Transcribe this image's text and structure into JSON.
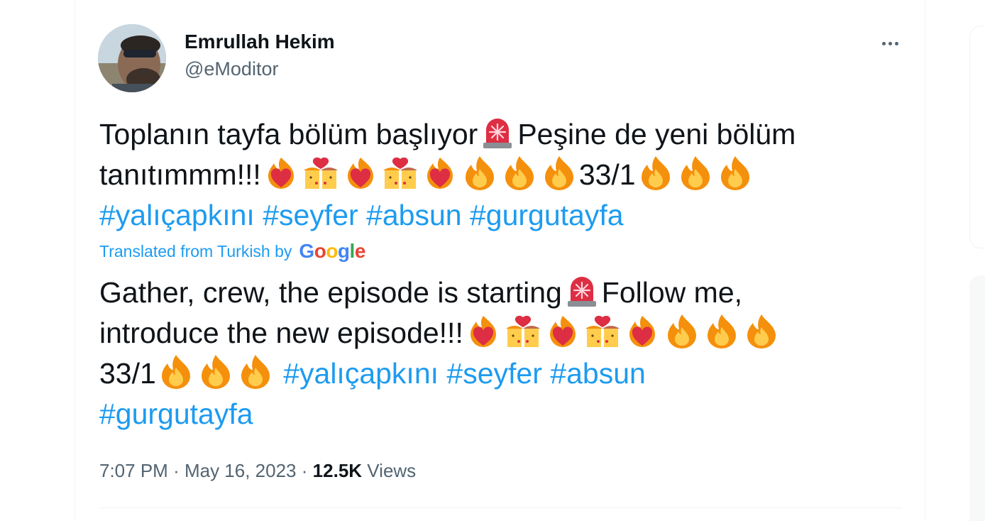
{
  "author": {
    "display_name": "Emrullah Hekim",
    "handle": "@eModitor"
  },
  "more_menu": {
    "icon": "more-horizontal-icon"
  },
  "tweet": {
    "original_lines": [
      [
        "Toplanın tayfa bölüm başlıyor",
        "emoji:rotating-light",
        "Peşine de yeni bölüm"
      ],
      [
        "tanıtımmm!!!",
        "emoji:heart-on-fire",
        "emoji:kiss",
        "emoji:heart-on-fire",
        "emoji:kiss",
        "emoji:heart-on-fire",
        "emoji:fire",
        "emoji:fire",
        "emoji:fire",
        "33/1",
        "emoji:fire",
        "emoji:fire",
        "emoji:fire"
      ],
      [
        "tag:#yalıçapkını",
        " ",
        "tag:#seyfer",
        " ",
        "tag:#absun",
        " ",
        "tag:#gurgutayfa"
      ]
    ],
    "translated_from": "Translated from Turkish by",
    "translation_provider": "Google",
    "translated_lines": [
      [
        "Gather, crew, the episode is starting",
        "emoji:rotating-light",
        "Follow me,"
      ],
      [
        "introduce the new episode!!!",
        "emoji:heart-on-fire",
        "emoji:kiss",
        "emoji:heart-on-fire",
        "emoji:kiss",
        "emoji:heart-on-fire",
        "emoji:fire",
        "emoji:fire",
        "emoji:fire"
      ],
      [
        "33/1",
        "emoji:fire",
        "emoji:fire",
        "emoji:fire",
        " ",
        "tag:#yalıçapkını",
        " ",
        "tag:#seyfer",
        " ",
        "tag:#absun"
      ],
      [
        "tag:#gurgutayfa"
      ]
    ]
  },
  "meta": {
    "time": "7:07 PM",
    "separator": "·",
    "date": "May 16, 2023",
    "views_count": "12.5K",
    "views_label": "Views"
  },
  "colors": {
    "link": "#1d9bf0",
    "text": "#0f1419",
    "secondary": "#536471",
    "divider": "#eff3f4"
  }
}
